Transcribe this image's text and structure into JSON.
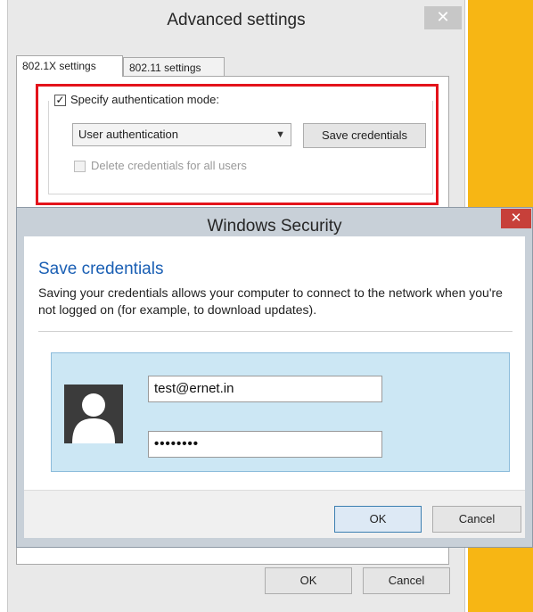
{
  "advanced_settings": {
    "title": "Advanced settings",
    "close_glyph": "✕",
    "tabs": [
      {
        "label": "802.1X settings",
        "active": true
      },
      {
        "label": "802.11 settings",
        "active": false
      }
    ],
    "specify_auth_mode": {
      "label": "Specify authentication mode:",
      "checked": true
    },
    "auth_mode_select": {
      "value": "User authentication"
    },
    "save_credentials_button": "Save credentials",
    "delete_credentials": {
      "label": "Delete credentials for all users",
      "checked": false,
      "enabled": false
    },
    "ok_button": "OK",
    "cancel_button": "Cancel"
  },
  "windows_security": {
    "title": "Windows Security",
    "close_glyph": "✕",
    "heading": "Save credentials",
    "description": "Saving your credentials allows your computer to connect to the network when you're not logged on (for example, to download updates).",
    "username_value": "test@ernet.in",
    "password_value": "••••••••",
    "ok_button": "OK",
    "cancel_button": "Cancel"
  },
  "colors": {
    "highlight_border": "#e3131b",
    "heading_blue": "#1a5fb4",
    "tile_background": "#cce7f4",
    "desktop_accent": "#f7b614"
  }
}
